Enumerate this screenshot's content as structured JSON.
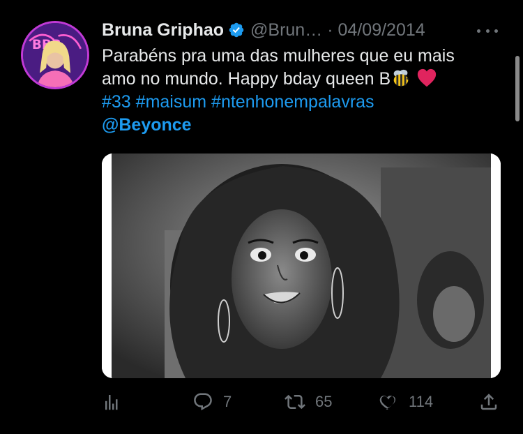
{
  "author": {
    "name": "Bruna Griphao",
    "handle": "@Brun…",
    "separator": "·",
    "date": "04/09/2014",
    "avatar_caption": "BBB"
  },
  "tweet": {
    "line1": "Parabéns pra uma das mulheres que eu mais",
    "line2": "amo no mundo. Happy bday queen B",
    "hashtag_33": "#33",
    "hashtag_maisum": "#maisum",
    "hashtag_ntenho": "#ntenhonempalavras",
    "mention": "@Beyonce",
    "emojis": [
      "bee-emoji",
      "red-heart-emoji"
    ]
  },
  "actions": {
    "replies": "7",
    "retweets": "65",
    "likes": "114"
  },
  "colors": {
    "background": "#000000",
    "text": "#e7e9ea",
    "muted": "#71767b",
    "accent": "#1d9bf0",
    "heart": "#e0245e"
  },
  "icons": [
    "verified-badge-icon",
    "more-icon",
    "analytics-icon",
    "reply-icon",
    "retweet-icon",
    "like-icon",
    "share-icon"
  ]
}
